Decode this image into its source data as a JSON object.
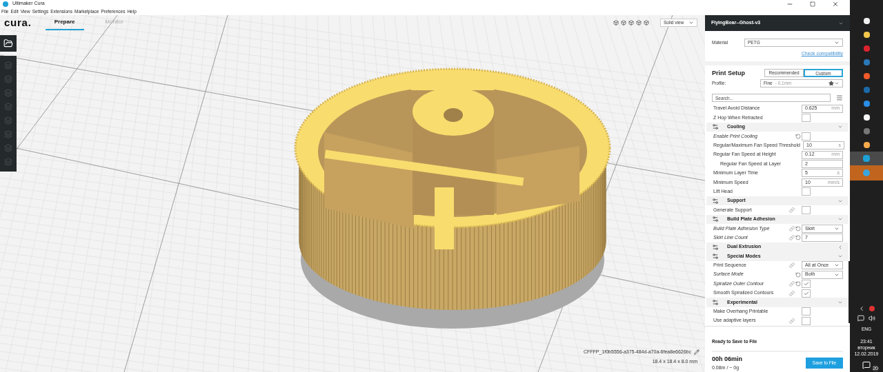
{
  "window": {
    "title": "Ultimaker Cura"
  },
  "menu": [
    "File",
    "Edit",
    "View",
    "Settings",
    "Extensions",
    "Marketplace",
    "Preferences",
    "Help"
  ],
  "logo": "cura.",
  "tabs": [
    {
      "label": "Prepare",
      "selected": true
    },
    {
      "label": "Monitor",
      "selected": false
    }
  ],
  "view_select": {
    "value": "Solid view"
  },
  "object": {
    "name": "CFFFP_1f0b5556-a375-484d-a70a-6fea8e6626bc",
    "dimensions": "18.4 x 18.4 x 8.0 mm"
  },
  "panel": {
    "printer": "FlyingBear--Ghost-v3",
    "material_label": "Material",
    "material": "PETG",
    "check_link": "Check compatibility",
    "setup_title": "Print Setup",
    "modes": [
      {
        "label": "Recommended",
        "selected": false
      },
      {
        "label": "Custom",
        "selected": true
      }
    ],
    "profile_label": "Profile:",
    "profile": "Fine",
    "profile_detail": "- 0.1mm",
    "search_placeholder": "Search..."
  },
  "settings": [
    {
      "kind": "text",
      "label": "Travel Avoid Distance",
      "value": "0.625",
      "unit": "mm"
    },
    {
      "kind": "checkbox",
      "label": "Z Hop When Retracted",
      "checked": false
    },
    {
      "kind": "section",
      "label": "Cooling",
      "expanded": true
    },
    {
      "kind": "checkbox",
      "label": "Enable Print Cooling",
      "checked": false,
      "italic": true,
      "reset": true
    },
    {
      "kind": "text",
      "label": "Regular/Maximum Fan Speed Threshold",
      "value": "10",
      "unit": "s"
    },
    {
      "kind": "text",
      "label": "Regular Fan Speed at Height",
      "value": "0.12",
      "unit": "mm",
      "children": [
        {
          "kind": "text",
          "label": "Regular Fan Speed at Layer",
          "value": "2"
        }
      ]
    },
    {
      "kind": "text",
      "label": "Minimum Layer Time",
      "value": "5",
      "unit": "s"
    },
    {
      "kind": "text",
      "label": "Minimum Speed",
      "value": "10",
      "unit": "mm/s"
    },
    {
      "kind": "checkbox",
      "label": "Lift Head",
      "checked": false
    },
    {
      "kind": "section",
      "label": "Support",
      "expanded": true
    },
    {
      "kind": "checkbox",
      "label": "Generate Support",
      "checked": false,
      "link": true
    },
    {
      "kind": "section",
      "label": "Build Plate Adhesion",
      "expanded": true
    },
    {
      "kind": "select",
      "label": "Build Plate Adhesion Type",
      "value": "Skirt",
      "italic": true,
      "link": true,
      "reset": true
    },
    {
      "kind": "text",
      "label": "Skirt Line Count",
      "value": "7",
      "italic": true,
      "link": true,
      "reset": true
    },
    {
      "kind": "section",
      "label": "Dual Extrusion",
      "expanded": false
    },
    {
      "kind": "section",
      "label": "Special Modes",
      "expanded": true
    },
    {
      "kind": "select",
      "label": "Print Sequence",
      "value": "All at Once",
      "link": true
    },
    {
      "kind": "select",
      "label": "Surface Mode",
      "value": "Both",
      "italic": true,
      "reset": true
    },
    {
      "kind": "checkbox",
      "label": "Spiralize Outer Contour",
      "checked": true,
      "italic": true,
      "link": true,
      "reset": true
    },
    {
      "kind": "checkbox",
      "label": "Smooth Spiralized Contours",
      "checked": true,
      "link": true
    },
    {
      "kind": "section",
      "label": "Experimental",
      "expanded": true
    },
    {
      "kind": "checkbox",
      "label": "Make Overhang Printable",
      "checked": false
    },
    {
      "kind": "checkbox",
      "label": "Use adaptive layers",
      "checked": false,
      "link": true
    }
  ],
  "output": {
    "status": "Ready to Save to File",
    "time": "00h 06min",
    "usage": "0.08m / ~ 0g",
    "button": "Save to File"
  },
  "taskbar": {
    "language": "ENG",
    "time": "23:41",
    "day": "вторник",
    "date": "12.02.2019",
    "notifications": "20"
  }
}
